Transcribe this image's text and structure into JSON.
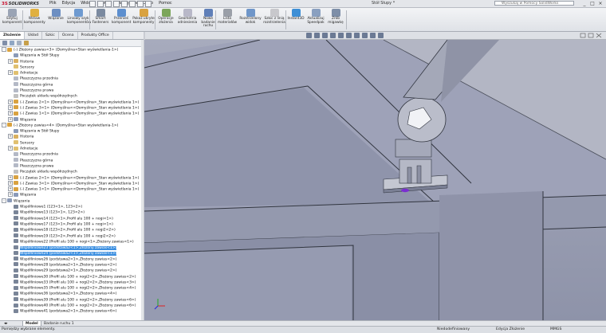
{
  "app": {
    "brand": "SOLIDWORKS",
    "document_title": "Stół Słupy *"
  },
  "menu": [
    "Plik",
    "Edycja",
    "Widok",
    "Wstaw",
    "Narzędzia",
    "Okno",
    "Pomoc"
  ],
  "search": {
    "placeholder": "Wyszukaj w Pomocy SolidWorks"
  },
  "window_buttons": [
    "_",
    "□",
    "×"
  ],
  "ribbon": [
    {
      "label": "Edytuj komponent",
      "icon": "edit-component-icon",
      "color": "#9aa4b5"
    },
    {
      "label": "Wstaw komponenty",
      "icon": "insert-components-icon",
      "color": "#e0b040"
    },
    {
      "label": "Wiązanie",
      "icon": "mate-icon",
      "color": "#6d8fc2"
    },
    {
      "label": "Liniowy szyk komponentów",
      "icon": "linear-pattern-icon",
      "color": "#6e9ad0"
    },
    {
      "label": "Smart Fasteners",
      "icon": "smart-fasteners-icon",
      "color": "#7b8aa0"
    },
    {
      "label": "Przenieś komponent",
      "icon": "move-component-icon",
      "color": "#5d8fcf"
    },
    {
      "label": "Pokaż ukryte komponenty",
      "icon": "show-hidden-icon",
      "color": "#d9a240"
    },
    {
      "label": "Operacje złożenia",
      "icon": "assembly-features-icon",
      "color": "#7ca65a"
    },
    {
      "label": "Geometria odniesienia",
      "icon": "reference-geometry-icon",
      "color": "#b8b8c8"
    },
    {
      "label": "Nowe badanie ruchu",
      "icon": "motion-study-icon",
      "color": "#5f7fb8"
    },
    {
      "label": "Lista materiałów",
      "icon": "bom-icon",
      "color": "#9a9fa8"
    },
    {
      "label": "Rozstrzelony widok",
      "icon": "exploded-view-icon",
      "color": "#6f96c9"
    },
    {
      "label": "Szkic z linią rozstrzelenia",
      "icon": "explode-line-icon",
      "color": "#c8c8cc"
    },
    {
      "label": "Instant3D",
      "icon": "instant3d-icon",
      "color": "#3d8fd6"
    },
    {
      "label": "Aktualizuj Speedpak",
      "icon": "speedpak-icon",
      "color": "#8aa0c0"
    },
    {
      "label": "Zrób migawkę",
      "icon": "snapshot-icon",
      "color": "#7e8fa8"
    }
  ],
  "command_tabs": [
    "Złożenie",
    "Układ",
    "Szkic",
    "Ocena",
    "Produkty Office"
  ],
  "tree": [
    {
      "indent": 0,
      "text": "(-) Złożony zawias<3> (Domyślna<Stan wyświetlania-1>)",
      "icon": "subassembly-icon",
      "color": "#d9a240",
      "tog": "-"
    },
    {
      "indent": 1,
      "text": "Wiązania w Stół Słupy",
      "icon": "mates-folder-icon",
      "color": "#8a9ab8",
      "tog": ""
    },
    {
      "indent": 1,
      "text": "Historia",
      "icon": "history-icon",
      "color": "#d9b060",
      "tog": "+"
    },
    {
      "indent": 1,
      "text": "Sensory",
      "icon": "sensors-icon",
      "color": "#e0c070",
      "tog": ""
    },
    {
      "indent": 1,
      "text": "Adnotacje",
      "icon": "annotations-icon",
      "color": "#e0c070",
      "tog": "+"
    },
    {
      "indent": 1,
      "text": "Płaszczyzna przednia",
      "icon": "plane-icon",
      "color": "#b4b9c6",
      "tog": ""
    },
    {
      "indent": 1,
      "text": "Płaszczyzna górna",
      "icon": "plane-icon",
      "color": "#b4b9c6",
      "tog": ""
    },
    {
      "indent": 1,
      "text": "Płaszczyzna prawa",
      "icon": "plane-icon",
      "color": "#b4b9c6",
      "tog": ""
    },
    {
      "indent": 1,
      "text": "Początek układu współrzędnych",
      "icon": "origin-icon",
      "color": "#c0c0c0",
      "tog": ""
    },
    {
      "indent": 1,
      "text": "(-) Zawias 2<1> (Domyślna<<Domyślna>_Stan wyświetlania 1>)",
      "icon": "part-icon",
      "color": "#d9a240",
      "tog": "+"
    },
    {
      "indent": 1,
      "text": "(-) Zawias 3<1> (Domyślna<<Domyślna>_Stan wyświetlania 1>)",
      "icon": "part-icon",
      "color": "#d9a240",
      "tog": "+"
    },
    {
      "indent": 1,
      "text": "(-) Zawias 1<1> (Domyślna<<Domyślna>_Stan wyświetlania 1>)",
      "icon": "part-icon",
      "color": "#d9a240",
      "tog": "+"
    },
    {
      "indent": 1,
      "text": "Wiązania",
      "icon": "mates-folder-icon",
      "color": "#8a9ab8",
      "tog": "+"
    },
    {
      "indent": 0,
      "text": "(-) Złożony zawias<4> (Domyślna<Stan wyświetlania-1>)",
      "icon": "subassembly-icon",
      "color": "#d9a240",
      "tog": "-"
    },
    {
      "indent": 1,
      "text": "Wiązania w Stół Słupy",
      "icon": "mates-folder-icon",
      "color": "#8a9ab8",
      "tog": ""
    },
    {
      "indent": 1,
      "text": "Historia",
      "icon": "history-icon",
      "color": "#d9b060",
      "tog": "+"
    },
    {
      "indent": 1,
      "text": "Sensory",
      "icon": "sensors-icon",
      "color": "#e0c070",
      "tog": ""
    },
    {
      "indent": 1,
      "text": "Adnotacje",
      "icon": "annotations-icon",
      "color": "#e0c070",
      "tog": "+"
    },
    {
      "indent": 1,
      "text": "Płaszczyzna przednia",
      "icon": "plane-icon",
      "color": "#b4b9c6",
      "tog": ""
    },
    {
      "indent": 1,
      "text": "Płaszczyzna górna",
      "icon": "plane-icon",
      "color": "#b4b9c6",
      "tog": ""
    },
    {
      "indent": 1,
      "text": "Płaszczyzna prawa",
      "icon": "plane-icon",
      "color": "#b4b9c6",
      "tog": ""
    },
    {
      "indent": 1,
      "text": "Początek układu współrzędnych",
      "icon": "origin-icon",
      "color": "#c0c0c0",
      "tog": ""
    },
    {
      "indent": 1,
      "text": "(-) Zawias 2<1> (Domyślna<<Domyślna>_Stan wyświetlania 1>)",
      "icon": "part-icon",
      "color": "#d9a240",
      "tog": "+"
    },
    {
      "indent": 1,
      "text": "(-) Zawias 3<1> (Domyślna<<Domyślna>_Stan wyświetlania 1>)",
      "icon": "part-icon",
      "color": "#d9a240",
      "tog": "+"
    },
    {
      "indent": 1,
      "text": "(-) Zawias 1<1> (Domyślna<<Domyślna>_Stan wyświetlania 1>)",
      "icon": "part-icon",
      "color": "#d9a240",
      "tog": "+"
    },
    {
      "indent": 1,
      "text": "Wiązania",
      "icon": "mates-folder-icon",
      "color": "#8a9ab8",
      "tog": "+"
    },
    {
      "indent": 0,
      "text": "Wiązania",
      "icon": "mates-folder-icon",
      "color": "#8a9ab8",
      "tog": "-"
    },
    {
      "indent": 1,
      "text": "Współliniowe1 (123<1>, 123<2>)",
      "icon": "mate-icon",
      "color": "#7a8598",
      "tog": ""
    },
    {
      "indent": 1,
      "text": "Współliniowe13 (123<1>, 123<2>)",
      "icon": "mate-icon",
      "color": "#7a8598",
      "tog": ""
    },
    {
      "indent": 1,
      "text": "Współliniowe14 (123<1>,Profil alu 100 + nogi<1>)",
      "icon": "mate-icon",
      "color": "#7a8598",
      "tog": ""
    },
    {
      "indent": 1,
      "text": "Współliniowe17 (123<1>,Profil alu 100 + nogi<1>)",
      "icon": "mate-icon",
      "color": "#7a8598",
      "tog": ""
    },
    {
      "indent": 1,
      "text": "Współliniowe18 (123<2>,Profil alu 100 + nogi2<2>)",
      "icon": "mate-icon",
      "color": "#7a8598",
      "tog": ""
    },
    {
      "indent": 1,
      "text": "Współliniowe19 (123<2>,Profil alu 100 + nogi2<2>)",
      "icon": "mate-icon",
      "color": "#7a8598",
      "tog": ""
    },
    {
      "indent": 1,
      "text": "Współliniowe22 (Profil alu 100 + nogi<1>,Złożony zawias<1>)",
      "icon": "mate-icon",
      "color": "#7a8598",
      "tog": ""
    },
    {
      "indent": 1,
      "text": "Współliniowe23 (podstawa2<1>,Złożony zawias<1>)",
      "icon": "mate-icon",
      "color": "#7a8598",
      "tog": "",
      "selected": true
    },
    {
      "indent": 1,
      "text": "Współliniowe24 (podstawa2<1>,Złożony zawias<1>)",
      "icon": "mate-icon",
      "color": "#7a8598",
      "tog": "",
      "selected": true
    },
    {
      "indent": 1,
      "text": "Współliniowe26 (podstawa2<1>,Złożony zawias<2>)",
      "icon": "mate-icon",
      "color": "#7a8598",
      "tog": ""
    },
    {
      "indent": 1,
      "text": "Współliniowe28 (podstawa2<1>,Złożony zawias<2>)",
      "icon": "mate-icon",
      "color": "#7a8598",
      "tog": ""
    },
    {
      "indent": 1,
      "text": "Współliniowe29 (podstawa2<1>,Złożony zawias<2>)",
      "icon": "mate-icon",
      "color": "#7a8598",
      "tog": ""
    },
    {
      "indent": 1,
      "text": "Współliniowe30 (Profil alu 100 + nogi2<2>,Złożony zawias<2>)",
      "icon": "mate-icon",
      "color": "#7a8598",
      "tog": ""
    },
    {
      "indent": 1,
      "text": "Współliniowe33 (Profil alu 100 + nogi2<2>,Złożony zawias<3>)",
      "icon": "mate-icon",
      "color": "#7a8598",
      "tog": ""
    },
    {
      "indent": 1,
      "text": "Współliniowe35 (Profil alu 100 + nogi2<2>,Złożony zawias<4>)",
      "icon": "mate-icon",
      "color": "#7a8598",
      "tog": ""
    },
    {
      "indent": 1,
      "text": "Współliniowe36 (podstawa2<1>,Złożony zawias<4>)",
      "icon": "mate-icon",
      "color": "#7a8598",
      "tog": ""
    },
    {
      "indent": 1,
      "text": "Współliniowe39 (Profil alu 100 + nogi2<2>,Złożony zawias<6>)",
      "icon": "mate-icon",
      "color": "#7a8598",
      "tog": ""
    },
    {
      "indent": 1,
      "text": "Współliniowe40 (Profil alu 100 + nogi2<2>,Złożony zawias<6>)",
      "icon": "mate-icon",
      "color": "#7a8598",
      "tog": ""
    },
    {
      "indent": 1,
      "text": "Współliniowe41 (podstawa2<1>,Złożony zawias<6>)",
      "icon": "mate-icon",
      "color": "#7a8598",
      "tog": ""
    }
  ],
  "bottom_tabs": [
    "Model",
    "Badanie ruchu 1"
  ],
  "status": {
    "left": "Pomiędzy wybrane elementy.",
    "mid": "Niedodefiniowany",
    "mode": "Edycja Złożenie",
    "units": "MMGS"
  },
  "colors": {
    "selection": "#3c8fe0",
    "viewport_bg": "#9aa0b8",
    "highlight": "#7a2fd0"
  }
}
